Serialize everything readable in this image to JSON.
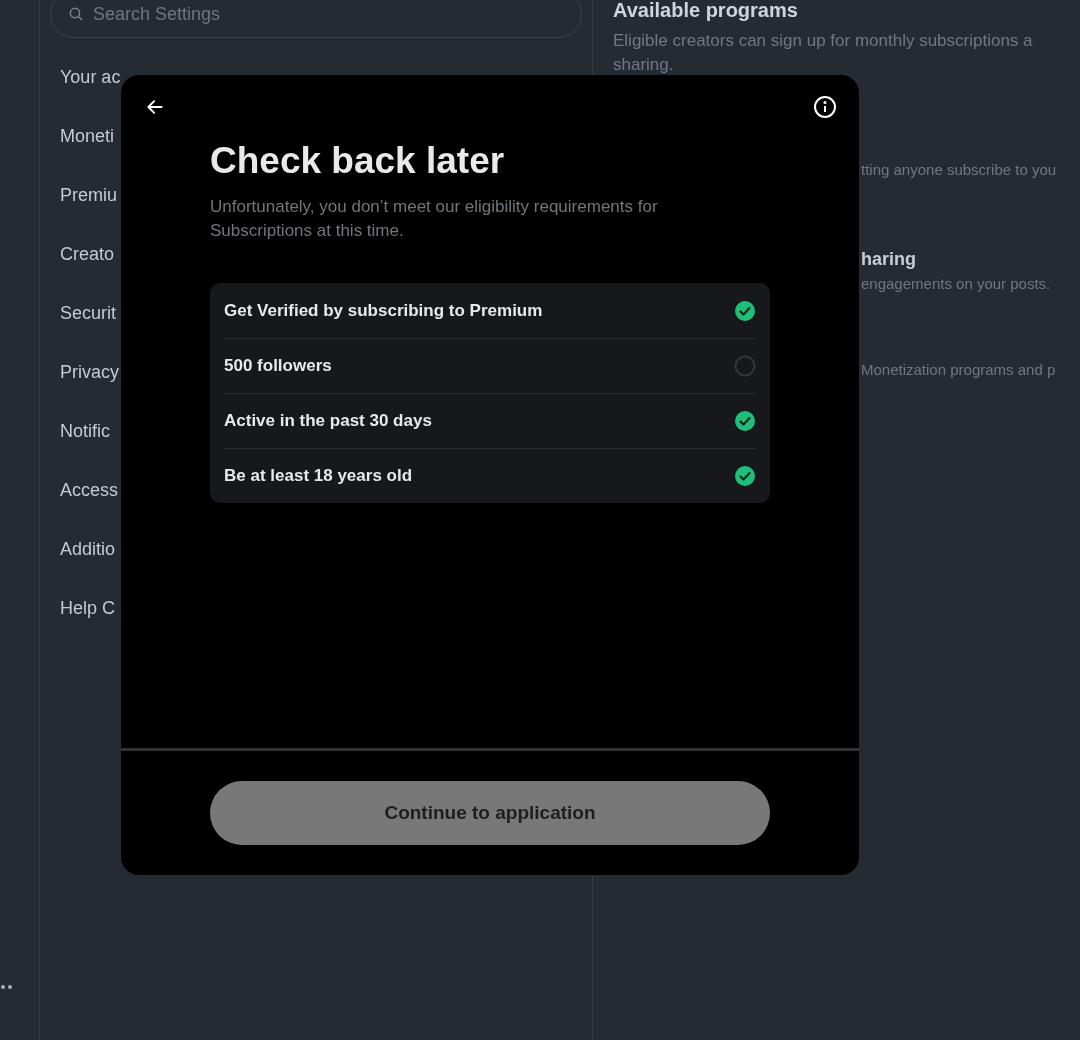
{
  "settings": {
    "search": {
      "placeholder": "Search Settings"
    },
    "items": [
      {
        "label": "Your ac"
      },
      {
        "label": "Moneti"
      },
      {
        "label": "Premiu"
      },
      {
        "label": "Creato"
      },
      {
        "label": "Securit"
      },
      {
        "label": "Privacy"
      },
      {
        "label": "Notific"
      },
      {
        "label": "Access"
      },
      {
        "label": "Additio"
      },
      {
        "label": "Help C"
      }
    ]
  },
  "programs": {
    "title": "Available programs",
    "description_lines": [
      "Eligible creators can sign up for monthly subscriptions a",
      "sharing."
    ],
    "visible_fragments": [
      {
        "kind": "text",
        "text": "tting anyone subscribe to you"
      },
      {
        "kind": "heading",
        "text": "haring"
      },
      {
        "kind": "text",
        "text": "engagements on your posts."
      },
      {
        "kind": "text",
        "text": "Monetization programs and p"
      }
    ]
  },
  "dialog": {
    "title": "Check back later",
    "subtitle": "Unfortunately, you don’t meet our eligibility requirements for Subscriptions at this time.",
    "requirements": [
      {
        "label": "Get Verified by subscribing to Premium",
        "checked": true
      },
      {
        "label": "500 followers",
        "checked": false
      },
      {
        "label": "Active in the past 30 days",
        "checked": true
      },
      {
        "label": "Be at least 18 years old",
        "checked": true
      }
    ],
    "button": {
      "label": "Continue to application",
      "disabled": true
    }
  }
}
